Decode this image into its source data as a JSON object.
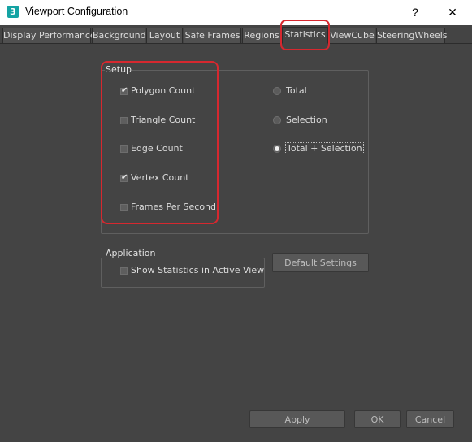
{
  "window": {
    "app_icon_glyph": "3",
    "title": "Viewport Configuration",
    "help_glyph": "?",
    "close_glyph": "✕"
  },
  "tabs": [
    {
      "label": "Display Performance",
      "active": false
    },
    {
      "label": "Background",
      "active": false
    },
    {
      "label": "Layout",
      "active": false
    },
    {
      "label": "Safe Frames",
      "active": false
    },
    {
      "label": "Regions",
      "active": false
    },
    {
      "label": "Statistics",
      "active": true
    },
    {
      "label": "ViewCube",
      "active": false
    },
    {
      "label": "SteeringWheels",
      "active": false
    }
  ],
  "setup": {
    "label": "Setup",
    "checkboxes": [
      {
        "label": "Polygon Count",
        "checked": true
      },
      {
        "label": "Triangle Count",
        "checked": false
      },
      {
        "label": "Edge Count",
        "checked": false
      },
      {
        "label": "Vertex Count",
        "checked": true
      },
      {
        "label": "Frames Per Second",
        "checked": false
      }
    ],
    "radios": [
      {
        "label": "Total",
        "selected": false
      },
      {
        "label": "Selection",
        "selected": false
      },
      {
        "label": "Total + Selection",
        "selected": true
      }
    ]
  },
  "application": {
    "label": "Application",
    "show_statistics": {
      "label": "Show Statistics in Active View",
      "checked": false
    }
  },
  "buttons": {
    "default_settings": "Default Settings",
    "apply": "Apply",
    "ok": "OK",
    "cancel": "Cancel"
  },
  "colors": {
    "dialog_background": "#444444",
    "highlight": "#d6282f"
  }
}
